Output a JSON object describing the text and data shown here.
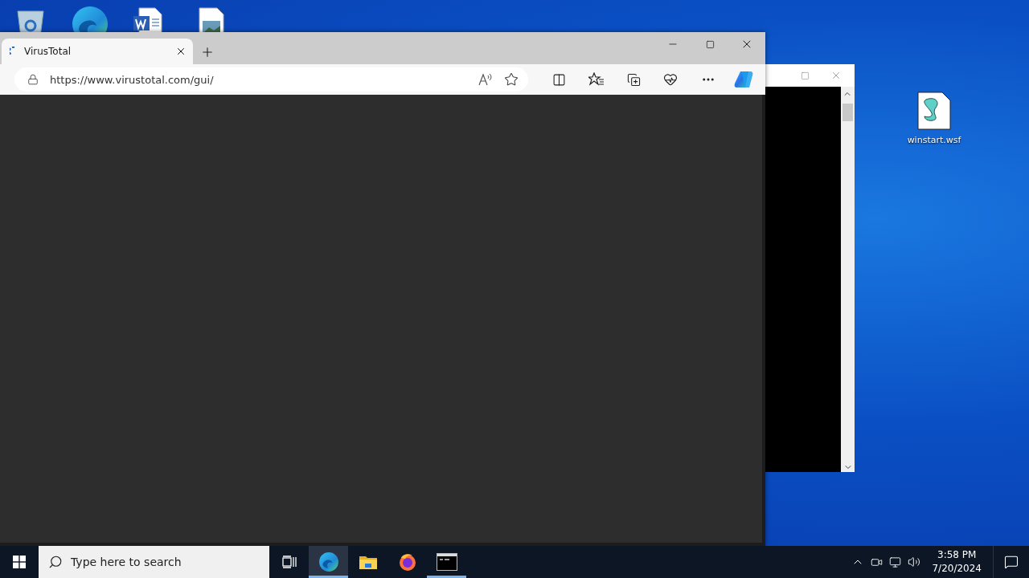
{
  "desktop": {
    "icons": [
      {
        "label": "winstart.wsf"
      }
    ]
  },
  "browser": {
    "tabs": [
      {
        "title": "VirusTotal",
        "selected": true
      }
    ],
    "address": "https://www.virustotal.com/gui/"
  },
  "taskbar": {
    "search": {
      "placeholder": "Type here to search"
    },
    "apps": [
      {
        "kind": "edge",
        "selected": true,
        "running": true
      },
      {
        "kind": "explorer",
        "selected": false,
        "running": false
      },
      {
        "kind": "firefox",
        "selected": false,
        "running": false
      },
      {
        "kind": "terminal",
        "selected": false,
        "running": true
      }
    ],
    "clock": {
      "time": "3:58 PM",
      "date": "7/20/2024"
    }
  }
}
